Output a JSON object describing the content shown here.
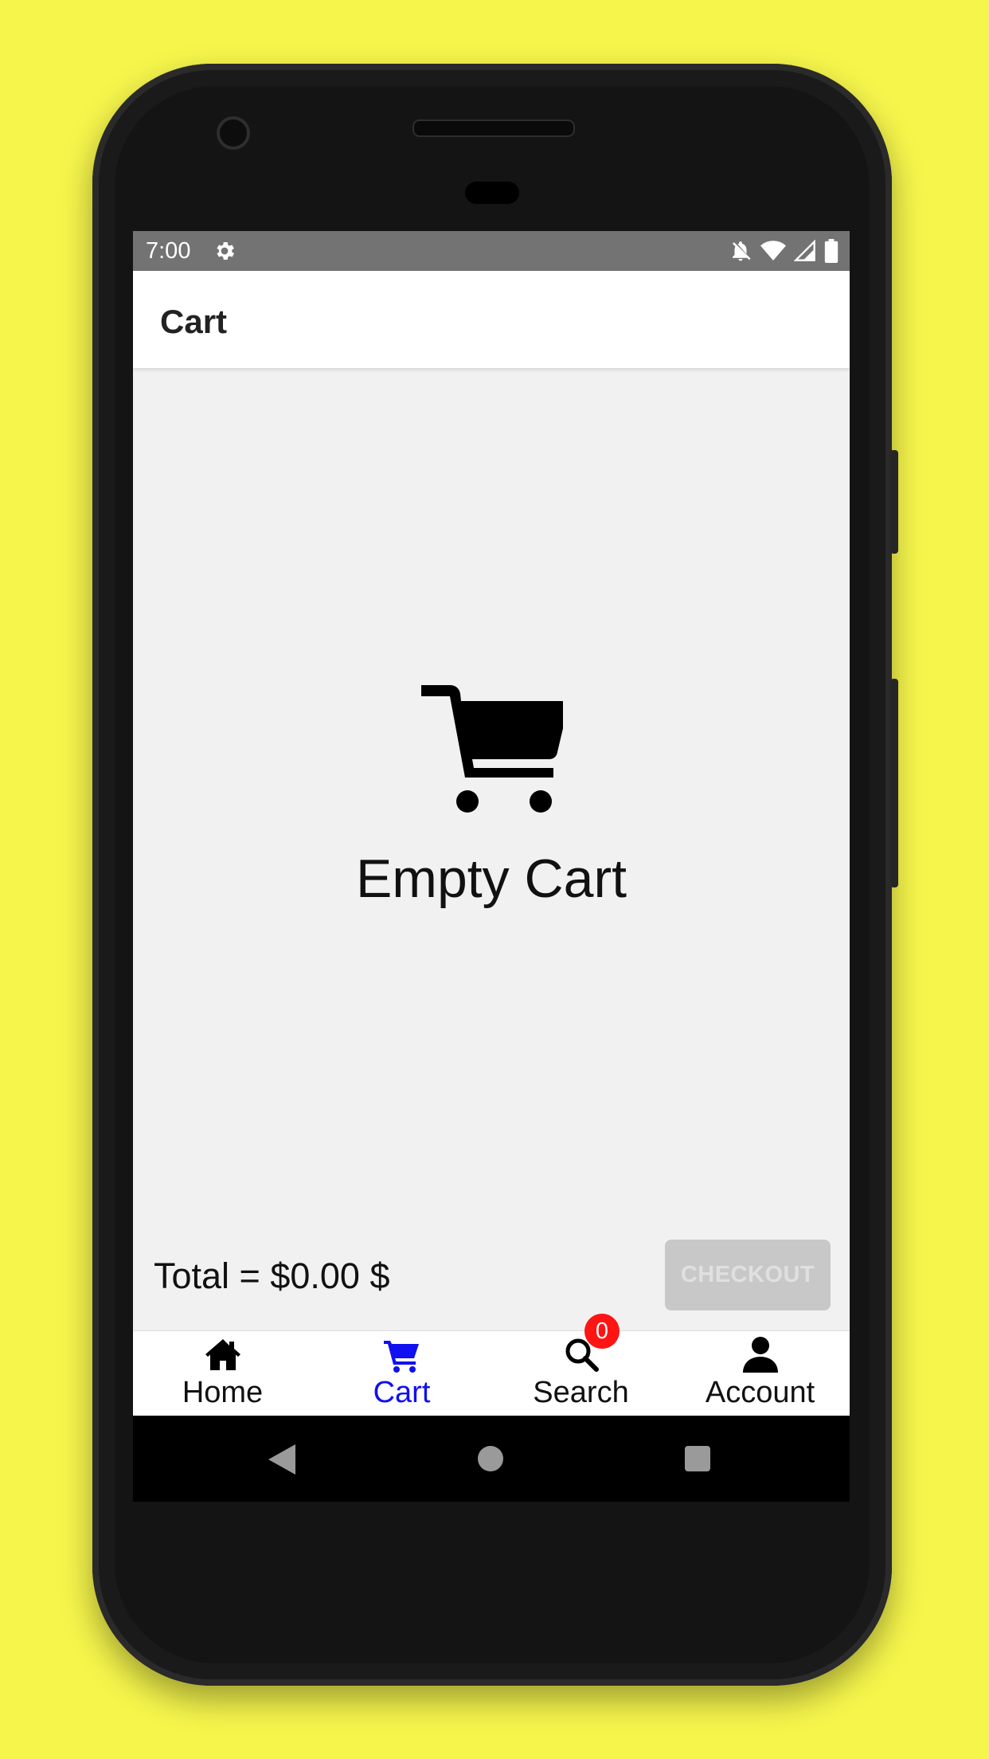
{
  "status_bar": {
    "time": "7:00"
  },
  "header": {
    "title": "Cart"
  },
  "empty_state": {
    "text": "Empty Cart"
  },
  "footer": {
    "total_text": "Total = $0.00 $",
    "checkout_label": "CHECKOUT"
  },
  "tabs": [
    {
      "label": "Home",
      "icon": "home-icon"
    },
    {
      "label": "Cart",
      "icon": "cart-icon",
      "badge": "0",
      "active": true
    },
    {
      "label": "Search",
      "icon": "search-icon"
    },
    {
      "label": "Account",
      "icon": "account-icon"
    }
  ],
  "colors": {
    "background": "#f5f54c",
    "active_tab": "#1010f0",
    "badge": "#ff1414",
    "checkout_disabled": "#c8c8c8",
    "status_bar": "#737373"
  }
}
